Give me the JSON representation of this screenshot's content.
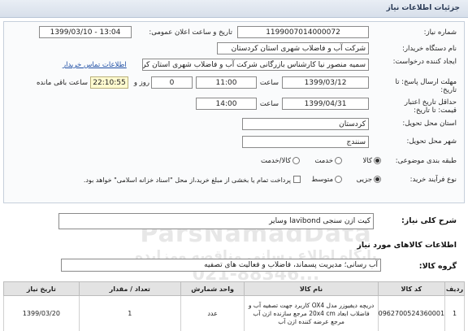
{
  "header": {
    "title": "جزئیات اطلاعات نیاز"
  },
  "fields": {
    "need_number_label": "شماره نیاز:",
    "need_number": "1199007014000072",
    "announce_label": "تاریخ و ساعت اعلان عمومی:",
    "announce_value": "1399/03/10 - 13:04",
    "buyer_label": "نام دستگاه خریدار:",
    "buyer_value": "شرکت آب و فاضلاب شهری استان کردستان",
    "creator_label": "ایجاد کننده درخواست:",
    "creator_value": "سمیه منصور نیا کارشناس بازرگانی شرکت آب و فاضلاب شهری استان کردستان",
    "contact_link": "اطلاعات تماس خریدار",
    "reply_deadline_label": "مهلت ارسال پاسخ: تا تاریخ:",
    "reply_date": "1399/03/12",
    "time_label": "ساعت",
    "reply_time": "11:00",
    "day_label": "روز و",
    "days": "0",
    "remaining_time": "22:10:55",
    "remaining_label": "ساعت باقی مانده",
    "price_validity_label": "حداقل تاریخ اعتبار قیمت: تا تاریخ:",
    "price_date": "1399/04/31",
    "price_time": "14:00",
    "province_label": "استان محل تحویل:",
    "province_value": "کردستان",
    "city_label": "شهر محل تحویل:",
    "city_value": "سنندج",
    "category_label": "طبقه بندی موضوعی:",
    "category_options": [
      "کالا",
      "خدمت",
      "کالا/خدمت"
    ],
    "category_selected": 0,
    "process_label": "نوع فرآیند خرید:",
    "process_options": [
      "جزیی",
      "متوسط"
    ],
    "process_selected": 0,
    "payment_note": "پرداخت تمام یا بخشی از مبلغ خرید،از محل \"اسناد خزانه اسلامی\" خواهد بود."
  },
  "summary": {
    "title": "شرح کلی نیاز:",
    "value": "کیت ازن سنجی lavibond وسایر"
  },
  "goods_section": {
    "title": "اطلاعات کالاهای مورد نیاز",
    "group_label": "گروه کالا:",
    "group_value": "آب رسانی؛ مدیریت پسماند، فاضلاب و فعالیت های تصفیه"
  },
  "table": {
    "headers": [
      "ردیف",
      "کد کالا",
      "نام کالا",
      "واحد شمارش",
      "تعداد / مقدار",
      "تاریخ نیاز"
    ],
    "rows": [
      {
        "index": "1",
        "code": "0962700524360001",
        "name": "دریچه دیفیوزر مدل OX4 کاربرد جهت تصفیه آب و فاضلاب ابعاد 20x4 cm مرجع سازنده ازن آب مرجع عرضه کننده ازن آب",
        "unit": "عدد",
        "qty": "1",
        "date": "1399/03/20"
      }
    ]
  },
  "watermark": {
    "line1": "ParsNamadData",
    "line2": "پایگاه اطلاع رسانی مناقصه ومزایده",
    "line3": "021-88346..."
  }
}
